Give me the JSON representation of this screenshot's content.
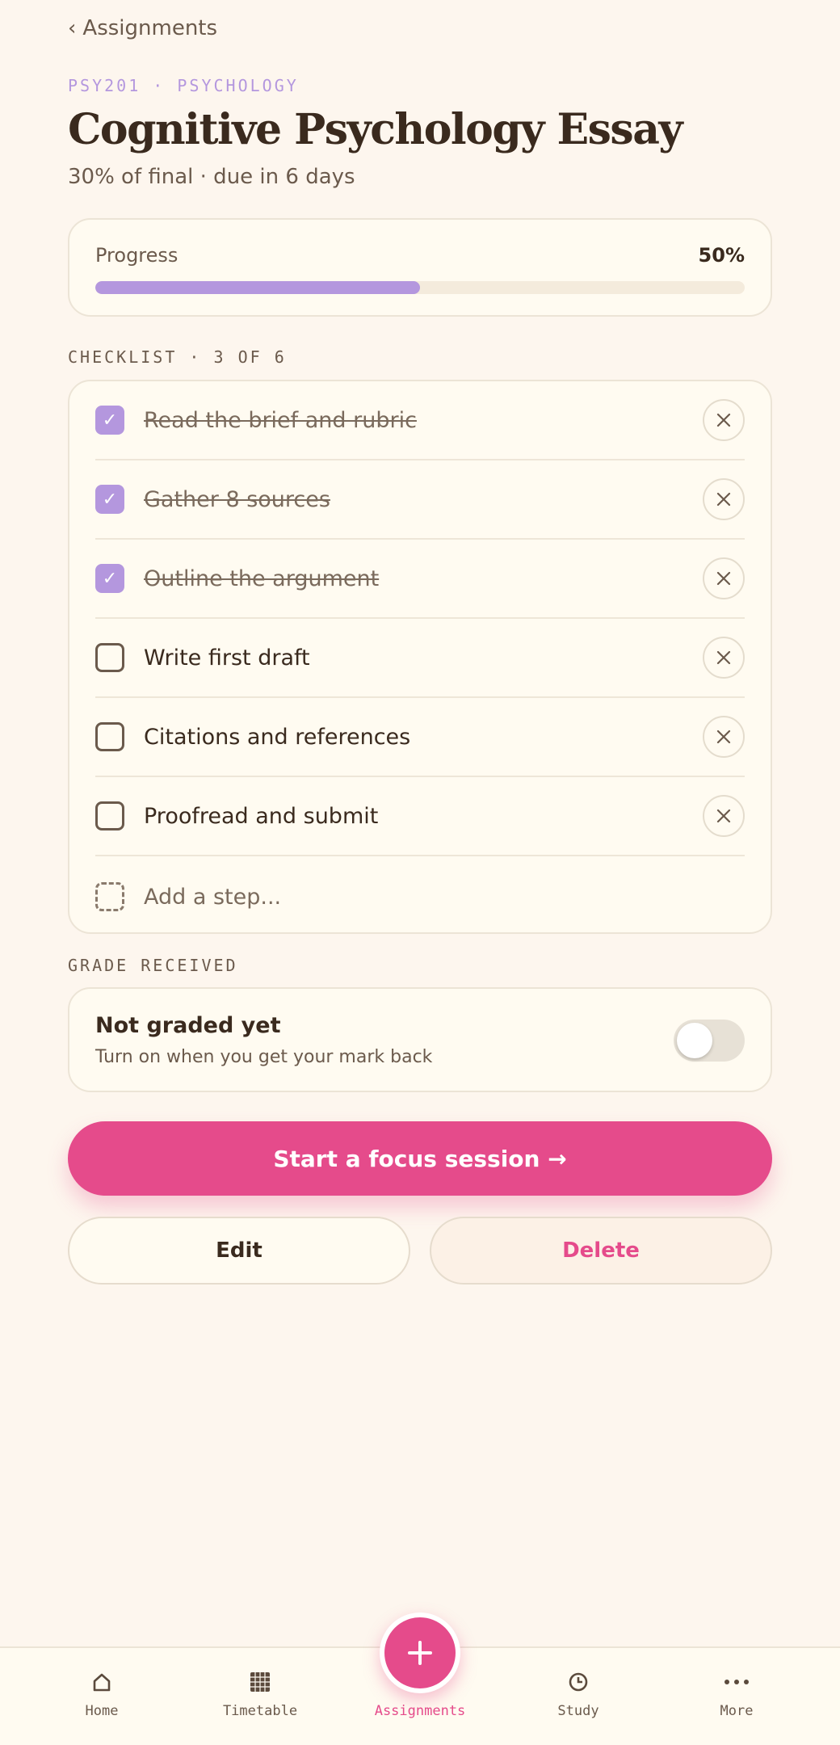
{
  "nav": {
    "back_label": "Assignments"
  },
  "header": {
    "course": "PSY201 · PSYCHOLOGY",
    "title": "Cognitive Psychology Essay",
    "subtitle": "30% of final · due in 6 days"
  },
  "progress": {
    "label": "Progress",
    "value_text": "50%",
    "fraction": 0.5
  },
  "checklist": {
    "section_label": "CHECKLIST · 3 OF 6",
    "items": [
      {
        "label": "Read the brief and rubric",
        "done": true
      },
      {
        "label": "Gather 8 sources",
        "done": true
      },
      {
        "label": "Outline the argument",
        "done": true
      },
      {
        "label": "Write first draft",
        "done": false
      },
      {
        "label": "Citations and references",
        "done": false
      },
      {
        "label": "Proofread and submit",
        "done": false
      }
    ],
    "add_placeholder": "Add a step..."
  },
  "grade": {
    "section_label": "GRADE RECEIVED",
    "title": "Not graded yet",
    "subtitle": "Turn on when you get your mark back",
    "toggle_on": false
  },
  "actions": {
    "focus_label": "Start a focus session →",
    "edit_label": "Edit",
    "delete_label": "Delete"
  },
  "tabbar": {
    "tabs": [
      {
        "label": "Home",
        "icon": "home-icon",
        "active": false
      },
      {
        "label": "Timetable",
        "icon": "grid-icon",
        "active": false
      },
      {
        "label": "Assignments",
        "icon": "plus-icon",
        "active": true
      },
      {
        "label": "Study",
        "icon": "clock-icon",
        "active": false
      },
      {
        "label": "More",
        "icon": "more-dots-icon",
        "active": false
      }
    ]
  },
  "colors": {
    "accent_pink": "#e54b8b",
    "accent_lavender": "#b497de",
    "background": "#fdf6ee",
    "card": "#fffbf1",
    "text": "#3a2a1e"
  }
}
